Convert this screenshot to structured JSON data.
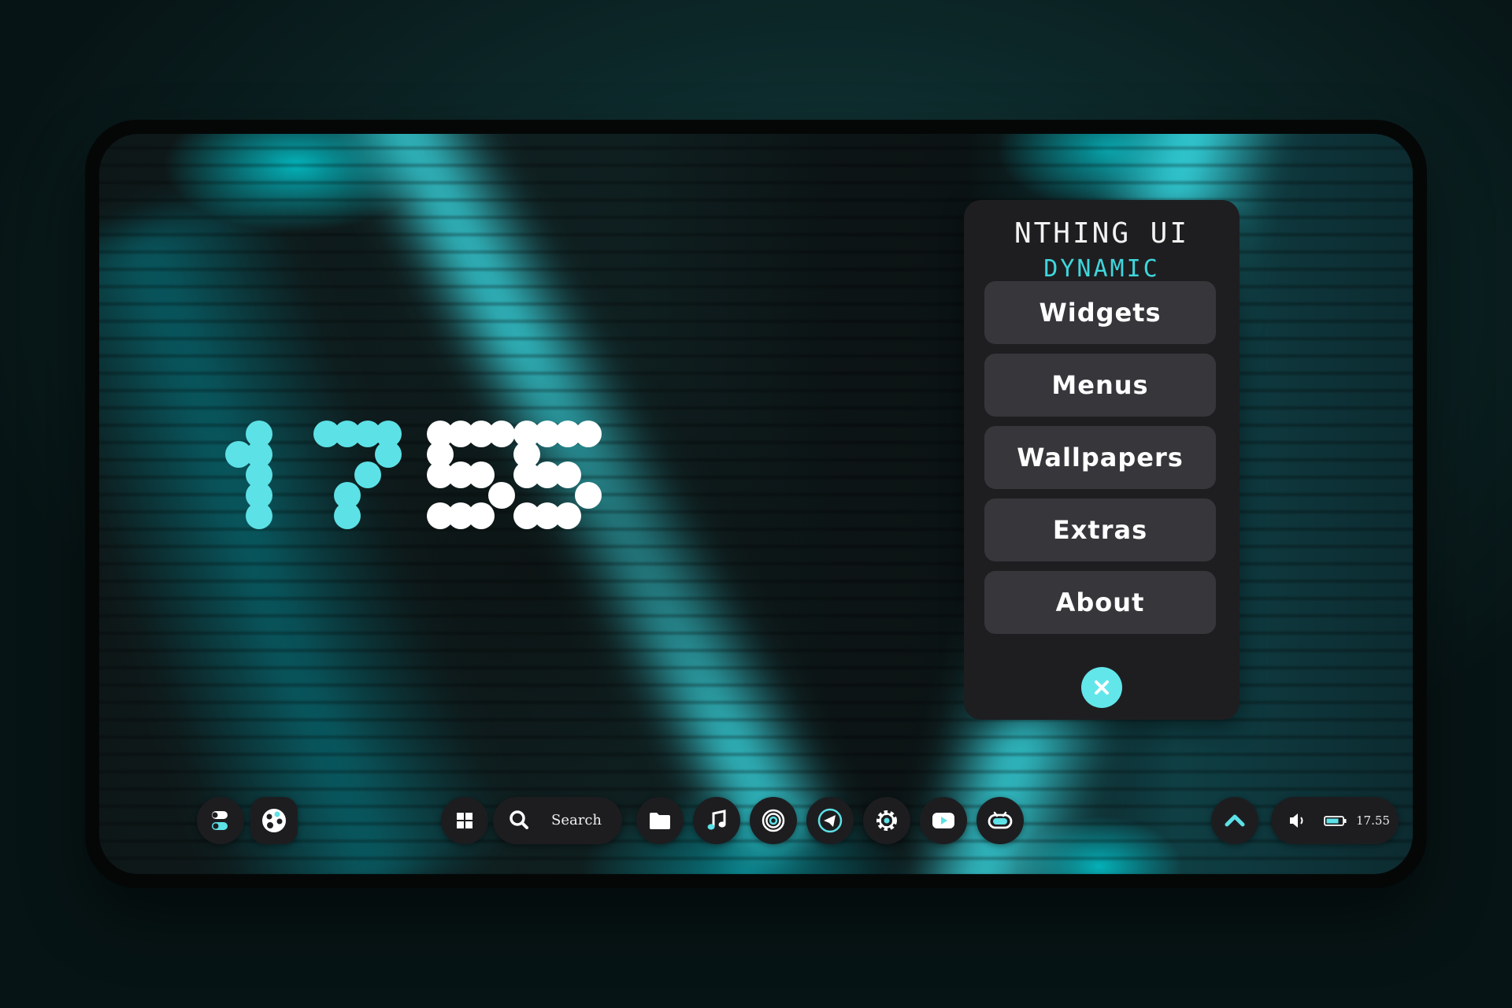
{
  "clock": {
    "time": "17:55",
    "hour_color": "#5ce1e6",
    "minute_color": "#ffffff"
  },
  "menu": {
    "title": "NTHING UI",
    "subtitle": "DYNAMIC",
    "items": [
      {
        "label": "Widgets"
      },
      {
        "label": "Menus"
      },
      {
        "label": "Wallpapers"
      },
      {
        "label": "Extras"
      },
      {
        "label": "About"
      }
    ],
    "close_icon": "close-icon"
  },
  "taskbar": {
    "left": [
      {
        "icon": "toggle-switches-icon"
      },
      {
        "icon": "palette-icon"
      }
    ],
    "start_icon": "windows-icon",
    "search": {
      "icon": "search-icon",
      "label": "Search"
    },
    "apps": [
      {
        "icon": "folder-icon"
      },
      {
        "icon": "music-note-icon"
      },
      {
        "icon": "rings-icon"
      },
      {
        "icon": "telegram-icon"
      },
      {
        "icon": "gear-icon"
      },
      {
        "icon": "youtube-icon"
      },
      {
        "icon": "robot-icon"
      }
    ],
    "tray": {
      "chevron_icon": "chevron-up-icon",
      "volume_icon": "volume-icon",
      "battery_icon": "battery-icon",
      "time": "17.55"
    }
  },
  "colors": {
    "accent": "#5ce1e6",
    "panel_bg": "#1e1e21",
    "button_bg": "#36363b",
    "taskbar_bg": "#1d1d20"
  }
}
